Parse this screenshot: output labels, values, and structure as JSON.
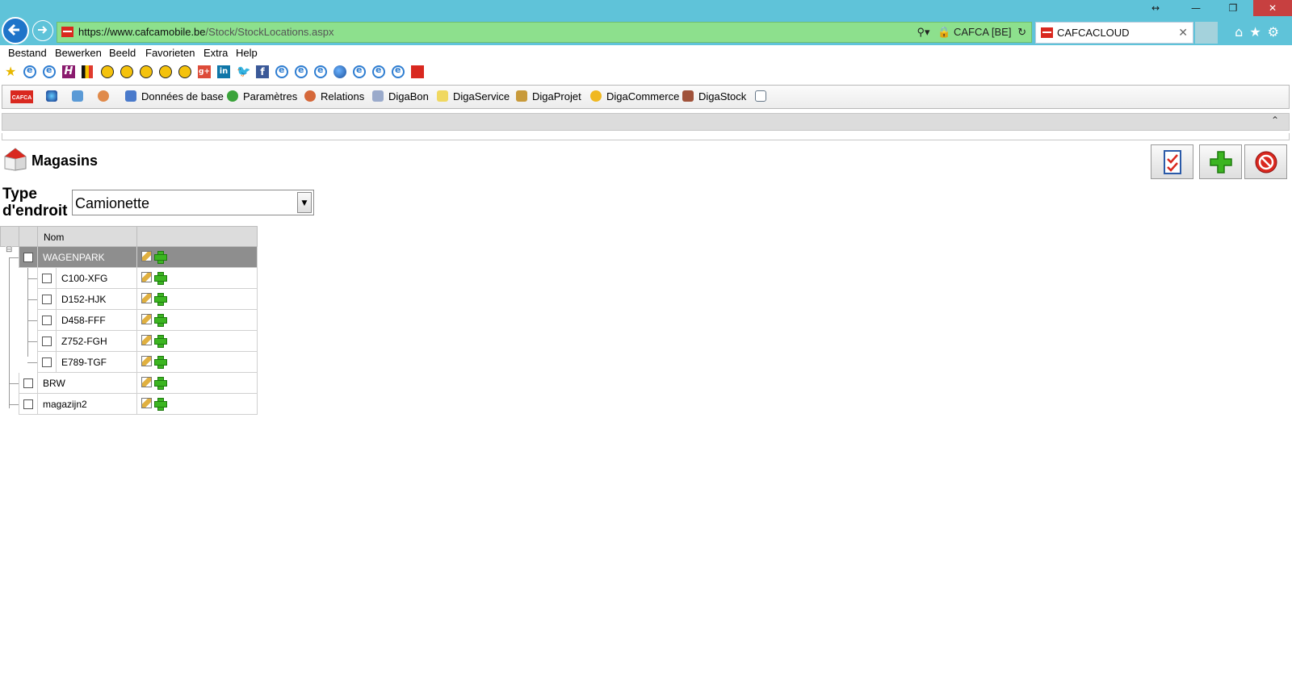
{
  "browser": {
    "url_prefix": "https://www.",
    "url_host": "cafcamobile.be",
    "url_path": "/Stock/StockLocations.aspx",
    "site_identity": "CAFCA [BE]",
    "tab_title": "CAFCACLOUD",
    "window_controls": [
      "↔",
      "—",
      "❐",
      "✕"
    ]
  },
  "menu": [
    "Bestand",
    "Bewerken",
    "Beeld",
    "Favorieten",
    "Extra",
    "Help"
  ],
  "app_toolbar": {
    "logo_text": "CAFCA",
    "items": [
      "Données de base",
      "Paramètres",
      "Relations",
      "DigaBon",
      "DigaService",
      "DigaProjet",
      "DigaCommerce",
      "DigaStock"
    ]
  },
  "page": {
    "title": "Magasins",
    "type_label_line1": "Type",
    "type_label_line2": "d'endroit",
    "type_value": "Camionette"
  },
  "grid": {
    "column_name": "Nom",
    "rows": [
      {
        "name": "WAGENPARK",
        "level": 0
      },
      {
        "name": "C100-XFG",
        "level": 1
      },
      {
        "name": "D152-HJK",
        "level": 1
      },
      {
        "name": "D458-FFF",
        "level": 1
      },
      {
        "name": "Z752-FGH",
        "level": 1
      },
      {
        "name": "E789-TGF",
        "level": 1
      },
      {
        "name": "BRW",
        "level": 0
      },
      {
        "name": "magazijn2",
        "level": 0
      }
    ],
    "expand_icon": "⊟"
  }
}
